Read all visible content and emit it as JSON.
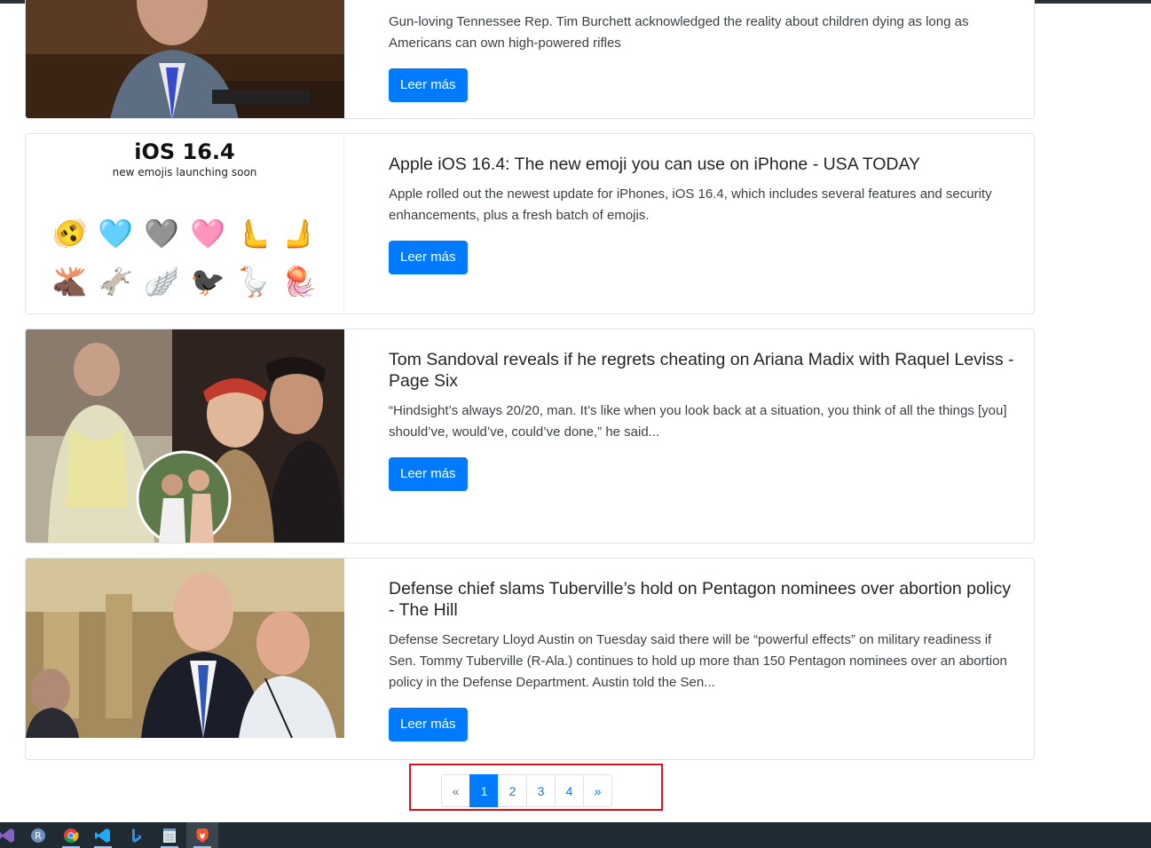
{
  "articles": [
    {
      "title": "",
      "description": "Gun-loving Tennessee Rep. Tim Burchett acknowledged the reality about children dying as long as Americans can own high-powered rifles",
      "button": "Leer más"
    },
    {
      "title": "Apple iOS 16.4: The new emoji you can use on iPhone - USA TODAY",
      "description": "Apple rolled out the newest update for iPhones, iOS 16.4, which includes several features and security enhancements, plus a fresh batch of emojis.",
      "button": "Leer más",
      "image_heading": "iOS 16.4",
      "image_subheading": "new emojis launching soon",
      "emojis_row1": [
        "🫨",
        "🩵",
        "🩶",
        "🩷",
        "🫷",
        "🫸"
      ],
      "emojis_row2": [
        "🫎",
        "🫏",
        "🪽",
        "🐦‍⬛",
        "🪿",
        "🪼"
      ]
    },
    {
      "title": "Tom Sandoval reveals if he regrets cheating on Ariana Madix with Raquel Leviss - Page Six",
      "description": "“Hindsight’s always 20/20, man. It’s like when you look back at a situation, you think of all the things [you] should’ve, would’ve, could’ve done,” he said...",
      "button": "Leer más"
    },
    {
      "title": "Defense chief slams Tuberville’s hold on Pentagon nominees over abortion policy - The Hill",
      "description": "Defense Secretary Lloyd Austin on Tuesday said there will be “powerful effects” on military readiness if Sen. Tommy Tuberville (R-Ala.) continues to hold up more than 150 Pentagon nominees over an abortion policy in the Defense Department. Austin told the Sen...",
      "button": "Leer más"
    }
  ],
  "pagination": {
    "prev": "«",
    "pages": [
      "1",
      "2",
      "3",
      "4"
    ],
    "active_page": "1",
    "next": "»"
  },
  "taskbar": {
    "icons": [
      "visual-studio-icon",
      "r-icon",
      "chrome-icon",
      "vscode-icon",
      "bing-icon",
      "notepad-icon",
      "brave-icon"
    ]
  },
  "colors": {
    "primary": "#007bff",
    "highlight": "#e0101a",
    "taskbar": "#1f2a33"
  }
}
